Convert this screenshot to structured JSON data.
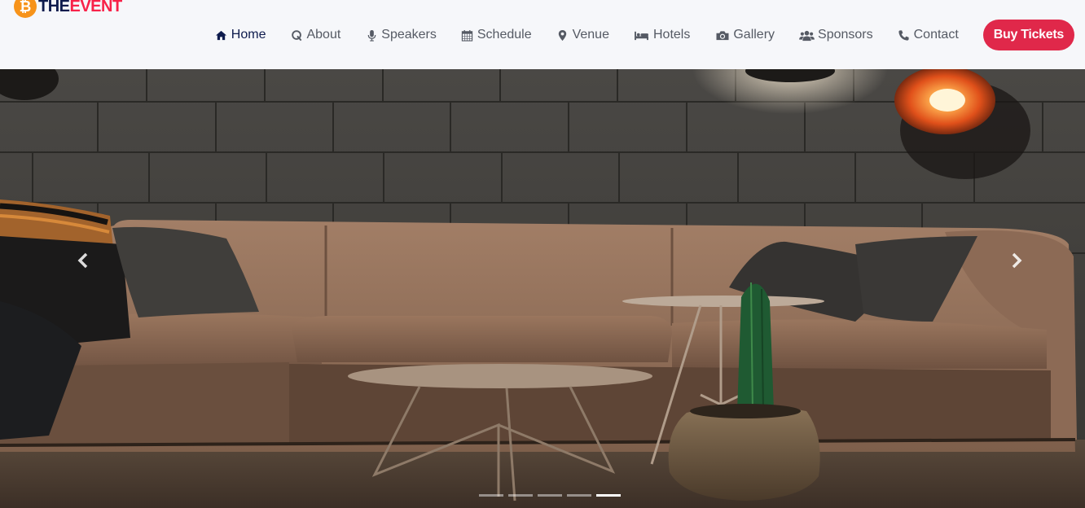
{
  "brand": {
    "part1": "THE",
    "part2": "EVENT",
    "coin_symbol": "₿",
    "coin_color": "#f7931a"
  },
  "nav": {
    "items": [
      {
        "label": "Home",
        "icon": "home-icon",
        "active": true
      },
      {
        "label": "About",
        "icon": "quora-icon",
        "active": false
      },
      {
        "label": "Speakers",
        "icon": "microphone-icon",
        "active": false
      },
      {
        "label": "Schedule",
        "icon": "calendar-icon",
        "active": false
      },
      {
        "label": "Venue",
        "icon": "map-marker-icon",
        "active": false
      },
      {
        "label": "Hotels",
        "icon": "bed-icon",
        "active": false
      },
      {
        "label": "Gallery",
        "icon": "camera-icon",
        "active": false
      },
      {
        "label": "Sponsors",
        "icon": "users-icon",
        "active": false
      },
      {
        "label": "Contact",
        "icon": "phone-icon",
        "active": false
      }
    ],
    "cta_label": "Buy Tickets",
    "cta_color": "#e0284a"
  },
  "hero": {
    "slides_count": 5,
    "active_slide": 5,
    "prev_icon": "chevron-left-icon",
    "next_icon": "chevron-right-icon"
  }
}
